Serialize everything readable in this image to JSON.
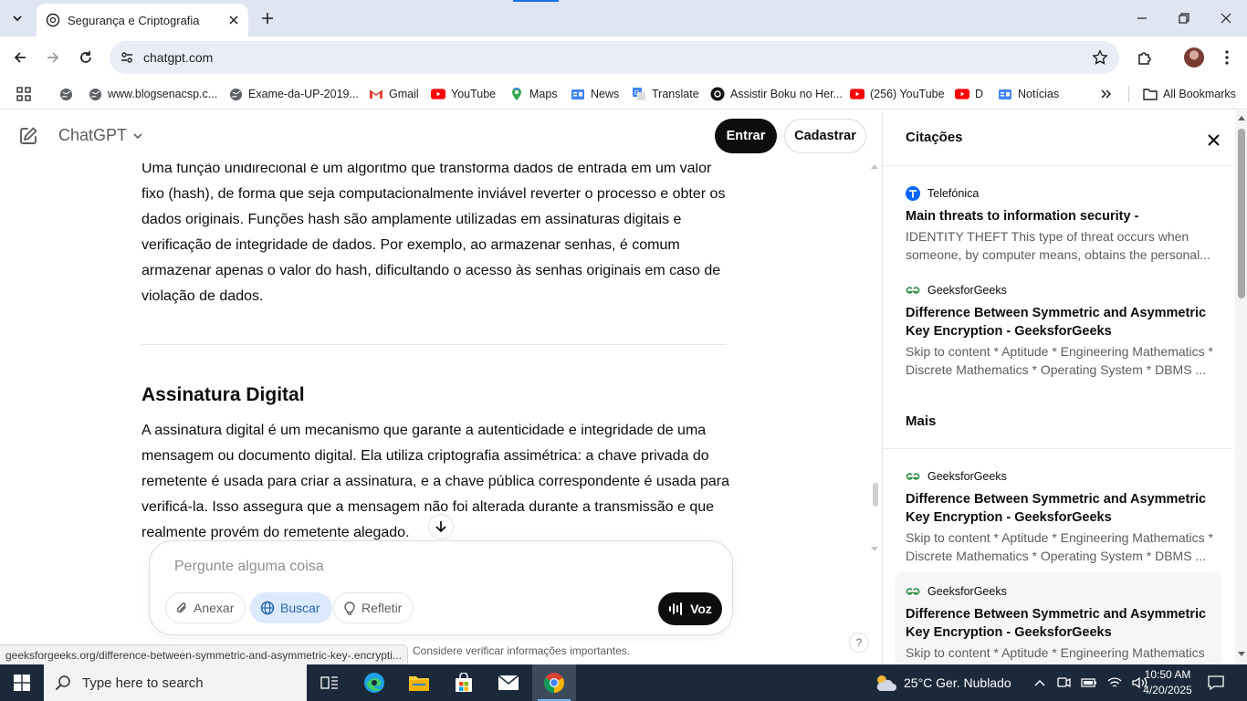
{
  "browser": {
    "tab_title": "Segurança e Criptografia",
    "url": "chatgpt.com",
    "bookmarks": [
      {
        "label": "www.blogsenacsp.c...",
        "icon": "globe-icon"
      },
      {
        "label": "Exame-da-UP-2019...",
        "icon": "globe-icon"
      },
      {
        "label": "Gmail",
        "icon": "gmail-icon"
      },
      {
        "label": "YouTube",
        "icon": "youtube-icon"
      },
      {
        "label": "Maps",
        "icon": "maps-icon"
      },
      {
        "label": "News",
        "icon": "news-icon"
      },
      {
        "label": "Translate",
        "icon": "translate-icon"
      },
      {
        "label": "Assistir Boku no Her...",
        "icon": "site-icon"
      },
      {
        "label": "(256) YouTube",
        "icon": "youtube-icon"
      },
      {
        "label": "D",
        "icon": "youtube-icon"
      },
      {
        "label": "Notícias",
        "icon": "news-icon"
      }
    ],
    "all_bookmarks": "All Bookmarks",
    "status_url": "geeksforgeeks.org/difference-between-symmetric-and-asymmetric-key-.encrypti..."
  },
  "chatgpt": {
    "model": "ChatGPT",
    "login": "Entrar",
    "signup": "Cadastrar",
    "paragraph1": "Uma função unidirecional é um algoritmo que transforma dados de entrada em um valor fixo (hash), de forma que seja computacionalmente inviável reverter o processo e obter os dados originais. Funções hash são amplamente utilizadas em assinaturas digitais e verificação de integridade de dados. Por exemplo, ao armazenar senhas, é comum armazenar apenas o valor do hash, dificultando o acesso às senhas originais em caso de violação de dados.",
    "heading": "Assinatura Digital",
    "paragraph2": "A assinatura digital é um mecanismo que garante a autenticidade e integridade de uma mensagem ou documento digital. Ela utiliza criptografia assimétrica: a chave privada do remetente é usada para criar a assinatura, e a chave pública correspondente é usada para verificá-la. Isso assegura que a mensagem não foi alterada durante a transmissão e que realmente provém do remetente alegado.",
    "composer_placeholder": "Pergunte alguma coisa",
    "attach": "Anexar",
    "search": "Buscar",
    "reason": "Refletir",
    "voice": "Voz",
    "disclaimer": "Considere verificar informações importantes.",
    "help": "?"
  },
  "citations": {
    "title": "Citações",
    "more": "Mais",
    "items": [
      {
        "source": "Telefónica",
        "title": "Main threats to information security -",
        "desc": "IDENTITY THEFT This type of threat occurs when someone, by computer means, obtains the personal..."
      },
      {
        "source": "GeeksforGeeks",
        "title": "Difference Between Symmetric and Asymmetric Key Encryption - GeeksforGeeks",
        "desc": "Skip to content * Aptitude * Engineering Mathematics * Discrete Mathematics * Operating System * DBMS ..."
      },
      {
        "source": "GeeksforGeeks",
        "title": "Difference Between Symmetric and Asymmetric Key Encryption - GeeksforGeeks",
        "desc": "Skip to content * Aptitude * Engineering Mathematics * Discrete Mathematics * Operating System * DBMS ..."
      },
      {
        "source": "GeeksforGeeks",
        "title": "Difference Between Symmetric and Asymmetric Key Encryption - GeeksforGeeks",
        "desc": "Skip to content * Aptitude * Engineering Mathematics"
      }
    ]
  },
  "taskbar": {
    "search_placeholder": "Type here to search",
    "weather": "25°C  Ger. Nublado",
    "time": "10:50 AM",
    "date": "4/20/2025"
  },
  "colors": {
    "accent_blue": "#1a73e8",
    "buscar_bg": "#dbeafe",
    "buscar_text": "#2964aa",
    "geeks_green": "#2f8d46",
    "youtube_red": "#ff0000"
  }
}
